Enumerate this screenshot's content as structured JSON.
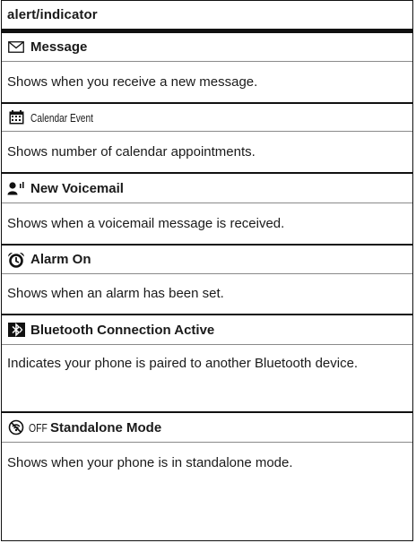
{
  "header": {
    "label": "alert/indicator"
  },
  "entries": [
    {
      "icon": "envelope-icon",
      "title": "Message",
      "desc": "Shows when you receive a new message."
    },
    {
      "icon": "calendar-icon",
      "title": "Calendar Event",
      "desc": "Shows number of calendar appointments."
    },
    {
      "icon": "voicemail-icon",
      "title": "New Voicemail",
      "desc": "Shows when a voicemail message is received."
    },
    {
      "icon": "alarm-clock-icon",
      "title": "Alarm On",
      "desc": "Shows when an alarm has been set."
    },
    {
      "icon": "bluetooth-icon",
      "title": "Bluetooth Connection Active",
      "desc": "Indicates your phone is paired to another Bluetooth device."
    },
    {
      "icon": "standalone-mode-icon",
      "prefix": "OFF",
      "title": "Standalone Mode",
      "desc": "Shows when your phone is in standalone mode."
    }
  ]
}
